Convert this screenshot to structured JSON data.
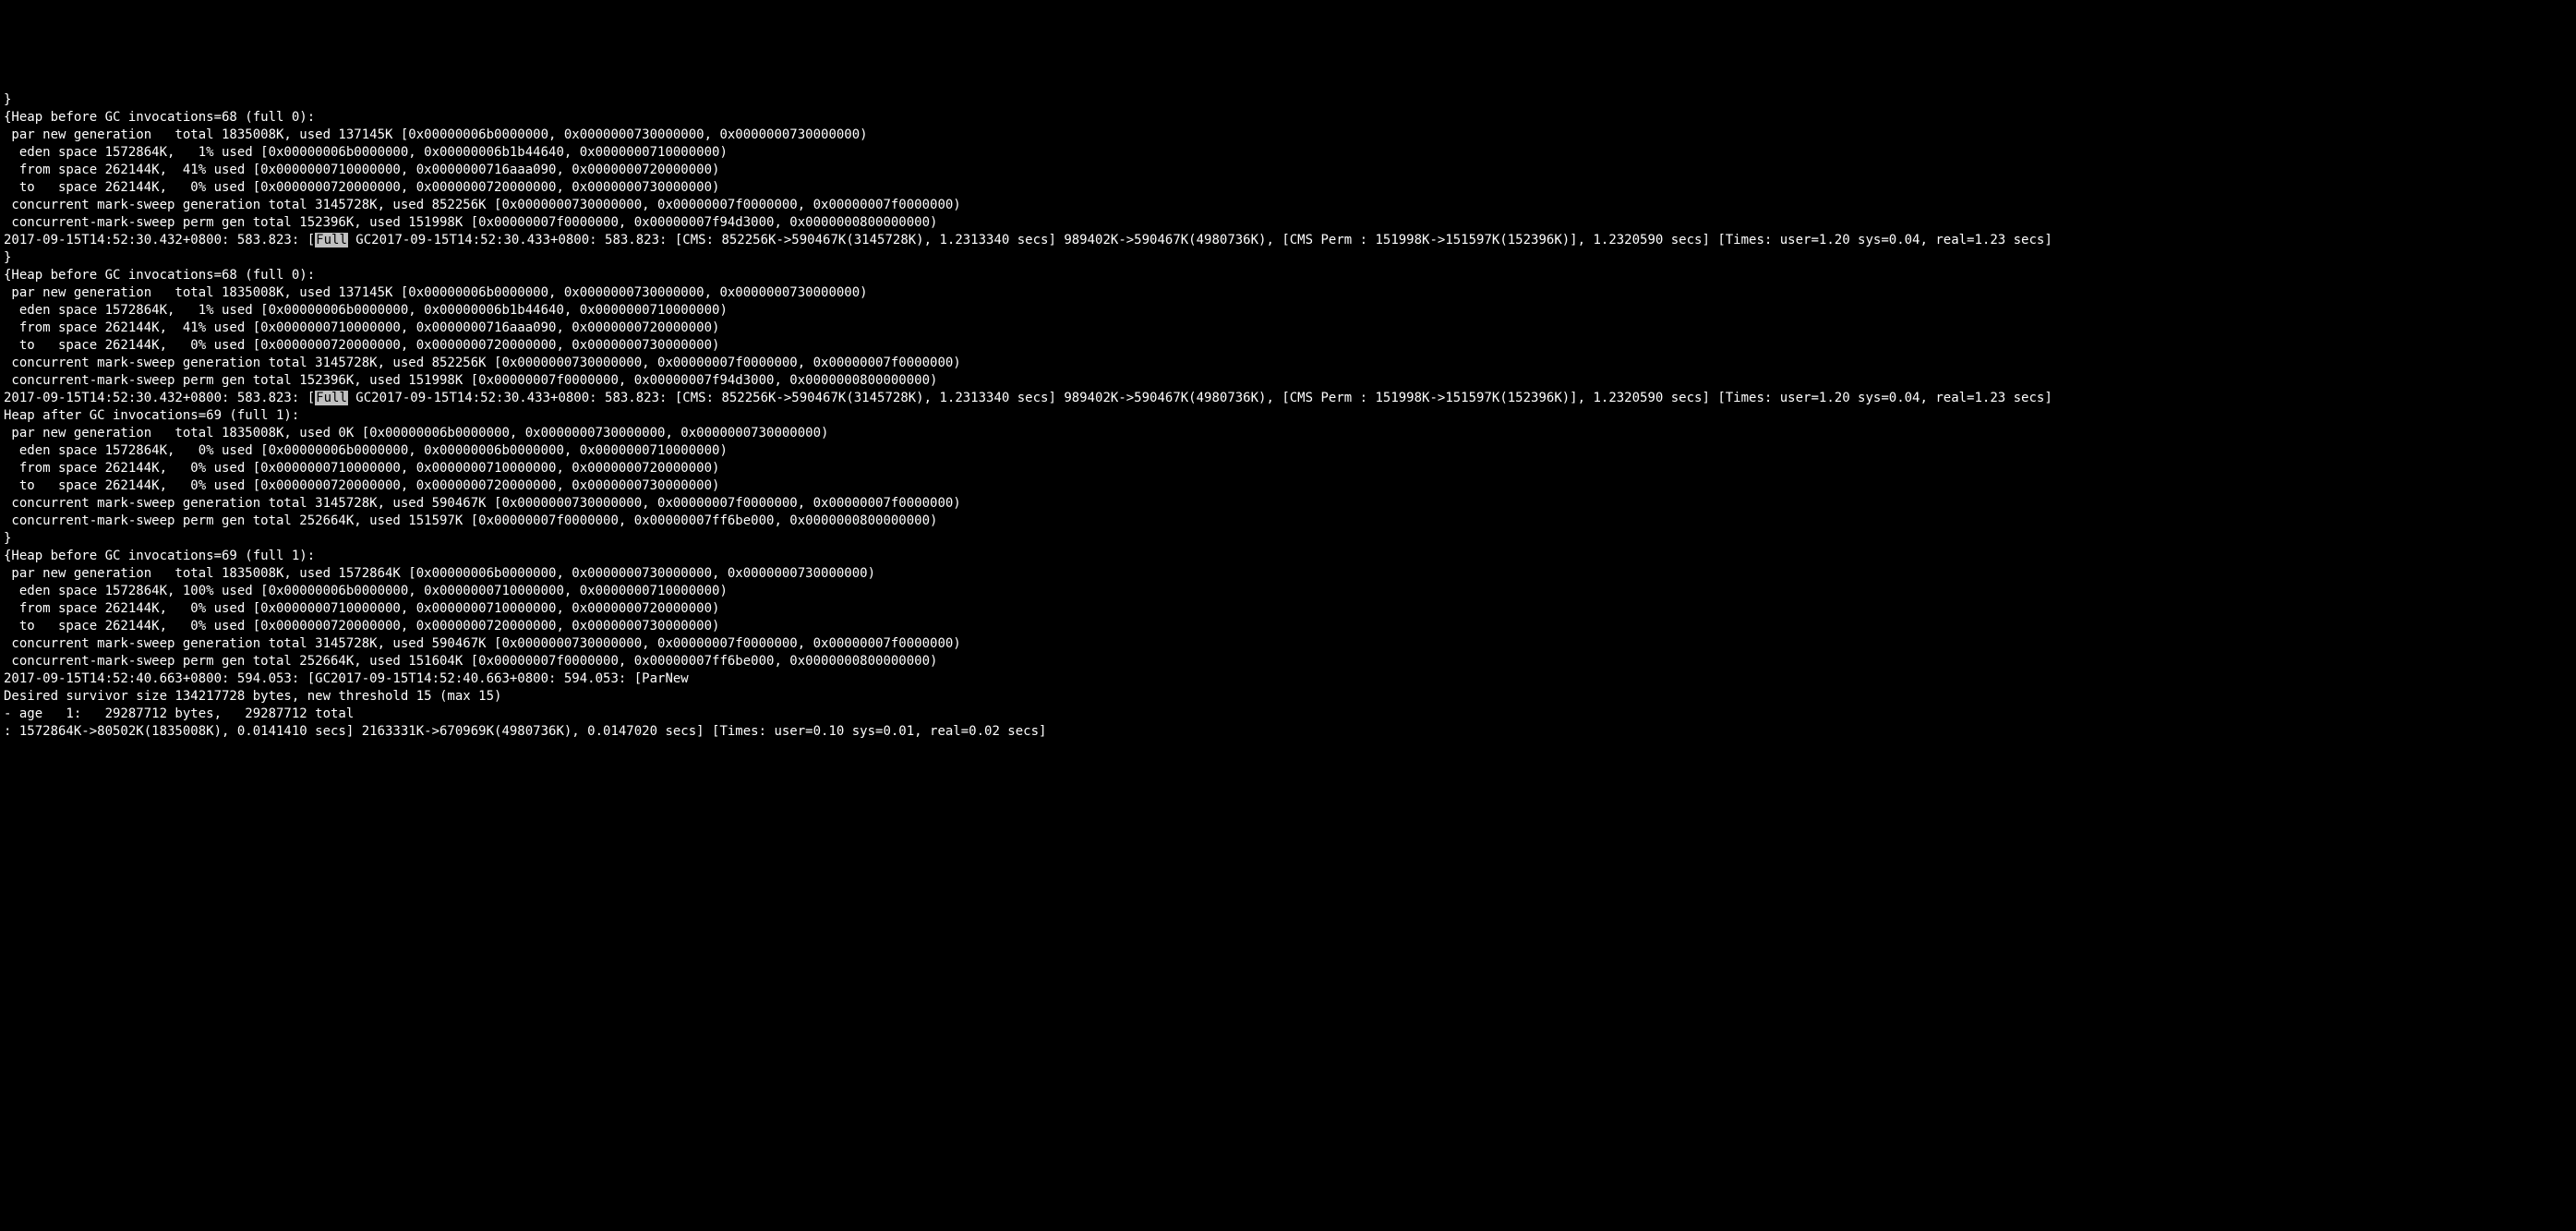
{
  "terminal": {
    "lines": [
      {
        "type": "plain",
        "text": "}"
      },
      {
        "type": "plain",
        "text": "{Heap before GC invocations=68 (full 0):"
      },
      {
        "type": "plain",
        "text": " par new generation   total 1835008K, used 137145K [0x00000006b0000000, 0x0000000730000000, 0x0000000730000000)"
      },
      {
        "type": "plain",
        "text": "  eden space 1572864K,   1% used [0x00000006b0000000, 0x00000006b1b44640, 0x0000000710000000)"
      },
      {
        "type": "plain",
        "text": "  from space 262144K,  41% used [0x0000000710000000, 0x0000000716aaa090, 0x0000000720000000)"
      },
      {
        "type": "plain",
        "text": "  to   space 262144K,   0% used [0x0000000720000000, 0x0000000720000000, 0x0000000730000000)"
      },
      {
        "type": "plain",
        "text": " concurrent mark-sweep generation total 3145728K, used 852256K [0x0000000730000000, 0x00000007f0000000, 0x00000007f0000000)"
      },
      {
        "type": "plain",
        "text": " concurrent-mark-sweep perm gen total 152396K, used 151998K [0x00000007f0000000, 0x00000007f94d3000, 0x0000000800000000)"
      },
      {
        "type": "full",
        "pre": "2017-09-15T14:52:30.432+0800: 583.823: [",
        "hl": "Full",
        "post": " GC2017-09-15T14:52:30.433+0800: 583.823: [CMS: 852256K->590467K(3145728K), 1.2313340 secs] 989402K->590467K(4980736K), [CMS Perm : 151998K->151597K(152396K)], 1.2320590 secs] [Times: user=1.20 sys=0.04, real=1.23 secs]"
      },
      {
        "type": "plain",
        "text": "}"
      },
      {
        "type": "plain",
        "text": "{Heap before GC invocations=68 (full 0):"
      },
      {
        "type": "plain",
        "text": " par new generation   total 1835008K, used 137145K [0x00000006b0000000, 0x0000000730000000, 0x0000000730000000)"
      },
      {
        "type": "plain",
        "text": "  eden space 1572864K,   1% used [0x00000006b0000000, 0x00000006b1b44640, 0x0000000710000000)"
      },
      {
        "type": "plain",
        "text": "  from space 262144K,  41% used [0x0000000710000000, 0x0000000716aaa090, 0x0000000720000000)"
      },
      {
        "type": "plain",
        "text": "  to   space 262144K,   0% used [0x0000000720000000, 0x0000000720000000, 0x0000000730000000)"
      },
      {
        "type": "plain",
        "text": " concurrent mark-sweep generation total 3145728K, used 852256K [0x0000000730000000, 0x00000007f0000000, 0x00000007f0000000)"
      },
      {
        "type": "plain",
        "text": " concurrent-mark-sweep perm gen total 152396K, used 151998K [0x00000007f0000000, 0x00000007f94d3000, 0x0000000800000000)"
      },
      {
        "type": "full",
        "pre": "2017-09-15T14:52:30.432+0800: 583.823: [",
        "hl": "Full",
        "post": " GC2017-09-15T14:52:30.433+0800: 583.823: [CMS: 852256K->590467K(3145728K), 1.2313340 secs] 989402K->590467K(4980736K), [CMS Perm : 151998K->151597K(152396K)], 1.2320590 secs] [Times: user=1.20 sys=0.04, real=1.23 secs]"
      },
      {
        "type": "plain",
        "text": "Heap after GC invocations=69 (full 1):"
      },
      {
        "type": "plain",
        "text": " par new generation   total 1835008K, used 0K [0x00000006b0000000, 0x0000000730000000, 0x0000000730000000)"
      },
      {
        "type": "plain",
        "text": "  eden space 1572864K,   0% used [0x00000006b0000000, 0x00000006b0000000, 0x0000000710000000)"
      },
      {
        "type": "plain",
        "text": "  from space 262144K,   0% used [0x0000000710000000, 0x0000000710000000, 0x0000000720000000)"
      },
      {
        "type": "plain",
        "text": "  to   space 262144K,   0% used [0x0000000720000000, 0x0000000720000000, 0x0000000730000000)"
      },
      {
        "type": "plain",
        "text": " concurrent mark-sweep generation total 3145728K, used 590467K [0x0000000730000000, 0x00000007f0000000, 0x00000007f0000000)"
      },
      {
        "type": "plain",
        "text": " concurrent-mark-sweep perm gen total 252664K, used 151597K [0x00000007f0000000, 0x00000007ff6be000, 0x0000000800000000)"
      },
      {
        "type": "plain",
        "text": "}"
      },
      {
        "type": "plain",
        "text": "{Heap before GC invocations=69 (full 1):"
      },
      {
        "type": "plain",
        "text": " par new generation   total 1835008K, used 1572864K [0x00000006b0000000, 0x0000000730000000, 0x0000000730000000)"
      },
      {
        "type": "plain",
        "text": "  eden space 1572864K, 100% used [0x00000006b0000000, 0x0000000710000000, 0x0000000710000000)"
      },
      {
        "type": "plain",
        "text": "  from space 262144K,   0% used [0x0000000710000000, 0x0000000710000000, 0x0000000720000000)"
      },
      {
        "type": "plain",
        "text": "  to   space 262144K,   0% used [0x0000000720000000, 0x0000000720000000, 0x0000000730000000)"
      },
      {
        "type": "plain",
        "text": " concurrent mark-sweep generation total 3145728K, used 590467K [0x0000000730000000, 0x00000007f0000000, 0x00000007f0000000)"
      },
      {
        "type": "plain",
        "text": " concurrent-mark-sweep perm gen total 252664K, used 151604K [0x00000007f0000000, 0x00000007ff6be000, 0x0000000800000000)"
      },
      {
        "type": "plain",
        "text": "2017-09-15T14:52:40.663+0800: 594.053: [GC2017-09-15T14:52:40.663+0800: 594.053: [ParNew"
      },
      {
        "type": "plain",
        "text": "Desired survivor size 134217728 bytes, new threshold 15 (max 15)"
      },
      {
        "type": "plain",
        "text": "- age   1:   29287712 bytes,   29287712 total"
      },
      {
        "type": "plain",
        "text": ": 1572864K->80502K(1835008K), 0.0141410 secs] 2163331K->670969K(4980736K), 0.0147020 secs] [Times: user=0.10 sys=0.01, real=0.02 secs]"
      }
    ]
  }
}
